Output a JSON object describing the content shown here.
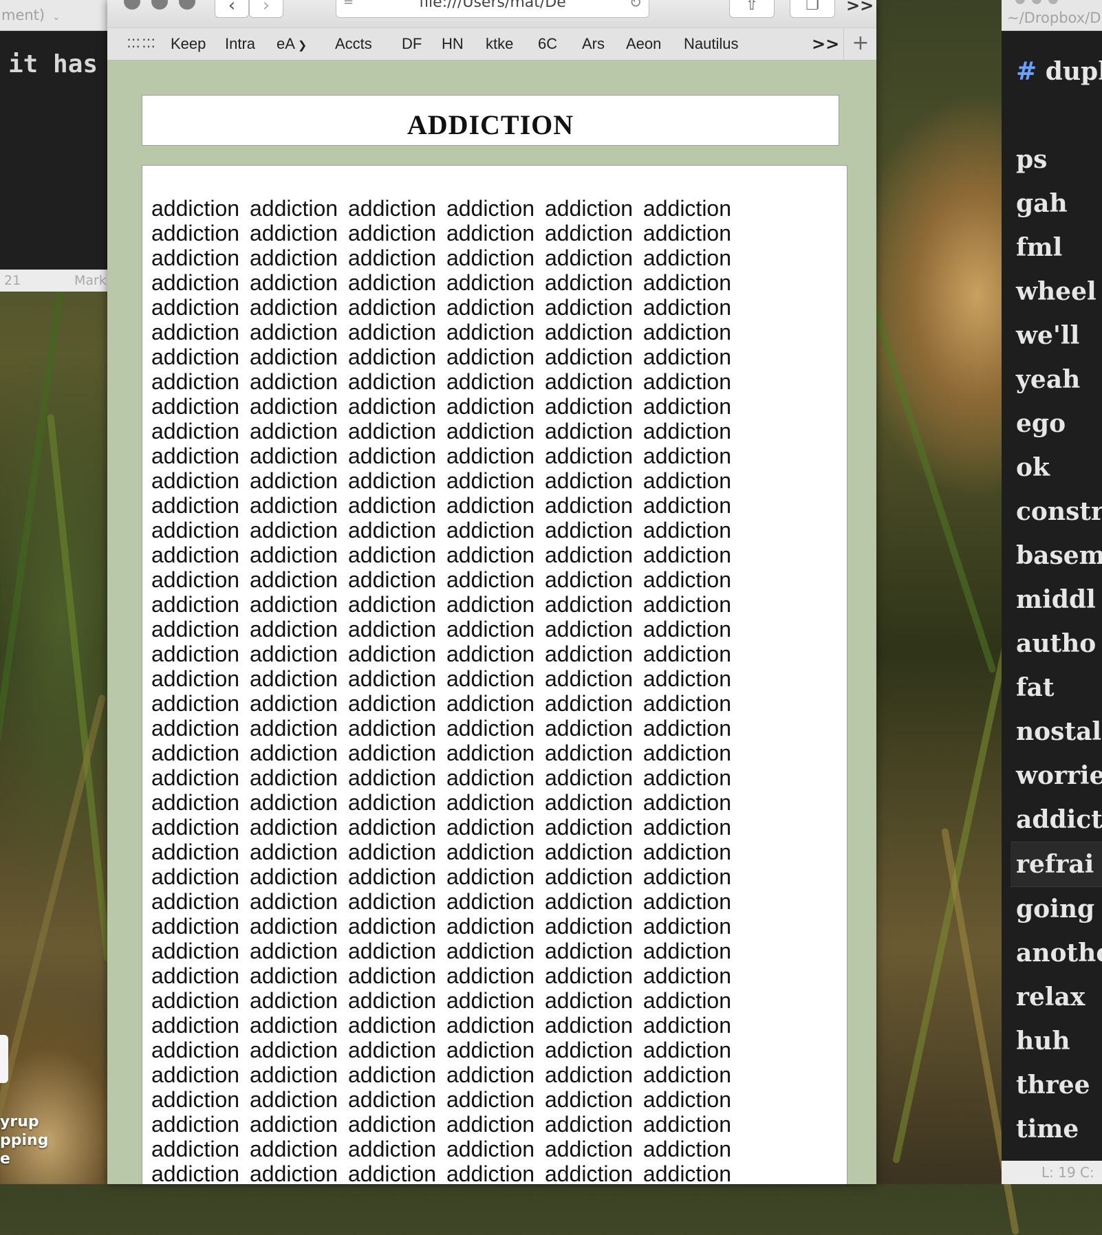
{
  "left_editor": {
    "title": "ment)",
    "code_text": "it has",
    "status_line": "21",
    "status_mode": "Mark"
  },
  "desktop": {
    "file_label_lines": [
      "yrup",
      "pping",
      "e"
    ]
  },
  "browser": {
    "address": "file:///Users/mat/De",
    "bookmarks": [
      "Keep",
      "Intra",
      "eA",
      "Accts",
      "DF",
      "HN",
      "ktke",
      "6C",
      "Ars",
      "Aeon",
      "Nautilus"
    ],
    "bookmarks_overflow": ">>",
    "toolbar_overflow": ">>"
  },
  "page": {
    "title": "ADDICTION",
    "repeated_word": "addiction",
    "words_per_line": 6,
    "visible_lines": 40
  },
  "right_editor": {
    "title": "~/Dropbox/D",
    "lines": [
      "# dupl",
      "",
      "ps",
      "gah",
      "fml",
      "wheel",
      "we'll",
      "yeah",
      "ego",
      "ok",
      "constr",
      "basem",
      "middl",
      "autho",
      "fat",
      "nostal",
      "worrie",
      "addict",
      "refrai",
      "going",
      "anothe",
      "relax",
      "huh",
      "three",
      "time"
    ],
    "current_line": 18,
    "status": "L: 19 C:"
  }
}
